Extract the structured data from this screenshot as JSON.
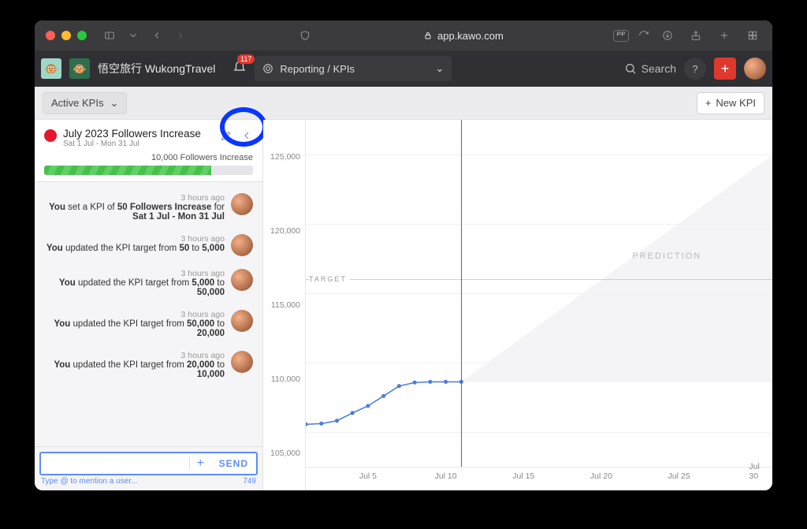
{
  "browser": {
    "url_host": "app.kawo.com",
    "pip_badge": "ᴾⁱᴾ"
  },
  "app": {
    "workspace_name": "悟空旅行 WukongTravel",
    "notification_count": "117",
    "breadcrumb_label": "Reporting / KPIs",
    "search_label": "Search"
  },
  "subbar": {
    "filter_label": "Active KPIs",
    "new_kpi_label": "New KPI"
  },
  "kpi": {
    "title": "July 2023 Followers Increase",
    "date_range": "Sat 1 Jul - Mon 31 Jul",
    "metric_label": "10,000 Followers Increase",
    "progress_pct": 80
  },
  "feed": [
    {
      "time": "3 hours ago",
      "html": "<b>You</b> set a KPI of <b>50 Followers Increase</b> for <b>Sat 1 Jul - Mon 31 Jul</b>"
    },
    {
      "time": "3 hours ago",
      "html": "<b>You</b> updated the KPI target from <b>50</b> to <b>5,000</b>"
    },
    {
      "time": "3 hours ago",
      "html": "<b>You</b> updated the KPI target from <b>5,000</b> to <b>50,000</b>"
    },
    {
      "time": "3 hours ago",
      "html": "<b>You</b> updated the KPI target from <b>50,000</b> to <b>20,000</b>"
    },
    {
      "time": "3 hours ago",
      "html": "<b>You</b> updated the KPI target from <b>20,000</b> to <b>10,000</b>"
    }
  ],
  "composer": {
    "placeholder": "",
    "send_label": "SEND",
    "hint": "Type @ to mention a user...",
    "char_limit": "749"
  },
  "chart_labels": {
    "target": "TARGET",
    "prediction": "PREDICTION"
  },
  "chart_data": {
    "type": "line",
    "title": "",
    "xlabel": "",
    "ylabel": "",
    "ylim": [
      102500,
      127500
    ],
    "y_ticks": [
      105000,
      110000,
      115000,
      120000,
      125000
    ],
    "y_tick_labels": [
      "105,000",
      "110,000",
      "115,000",
      "120,000",
      "125,000"
    ],
    "x_domain": [
      1,
      31
    ],
    "x_ticks": [
      5,
      10,
      15,
      20,
      25,
      30
    ],
    "x_tick_labels": [
      "Jul 5",
      "Jul 10",
      "Jul 15",
      "Jul 20",
      "Jul 25",
      "Jul 30"
    ],
    "today_x": 11,
    "target_y": 116000,
    "series": [
      {
        "name": "Followers",
        "color": "#4a7dde",
        "points": [
          {
            "x": 1,
            "y": 106000
          },
          {
            "x": 2,
            "y": 106050
          },
          {
            "x": 3,
            "y": 106250
          },
          {
            "x": 4,
            "y": 106800
          },
          {
            "x": 5,
            "y": 107300
          },
          {
            "x": 6,
            "y": 108000
          },
          {
            "x": 7,
            "y": 108700
          },
          {
            "x": 8,
            "y": 108950
          },
          {
            "x": 9,
            "y": 109000
          },
          {
            "x": 10,
            "y": 109000
          },
          {
            "x": 11,
            "y": 109000
          }
        ]
      }
    ],
    "prediction_cone": {
      "x0": 11,
      "y0": 109000,
      "x1": 31,
      "y1_low": 109000,
      "y1_high": 125000
    }
  }
}
